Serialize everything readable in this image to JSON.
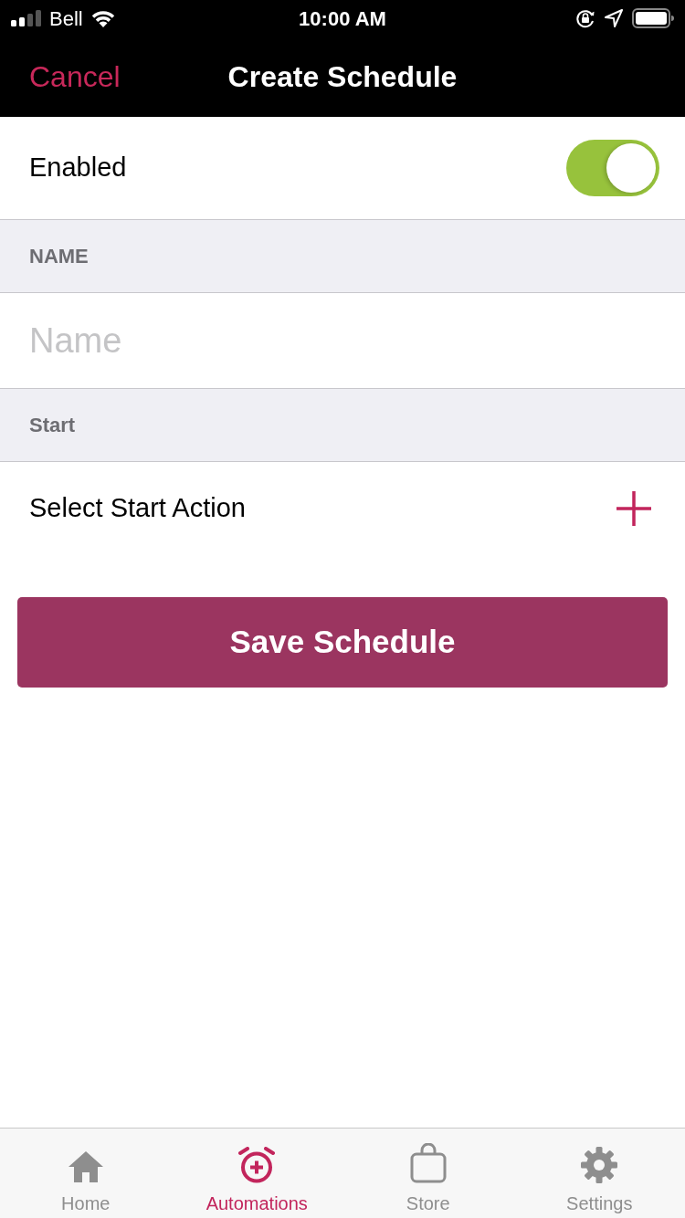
{
  "status_bar": {
    "carrier": "Bell",
    "time": "10:00 AM"
  },
  "nav_bar": {
    "left_button": "Cancel",
    "title": "Create Schedule"
  },
  "enabled_row": {
    "label": "Enabled",
    "on": true
  },
  "sections": [
    {
      "header": "NAME",
      "kind": "input",
      "placeholder": "Name"
    },
    {
      "header": "Start",
      "kind": "action",
      "label": "Select Start Action"
    }
  ],
  "save_button": "Save Schedule",
  "tab_bar": [
    {
      "label": "Home",
      "selected": false
    },
    {
      "label": "Automations",
      "selected": true
    },
    {
      "label": "Store",
      "selected": false
    },
    {
      "label": "Settings",
      "selected": false
    }
  ]
}
